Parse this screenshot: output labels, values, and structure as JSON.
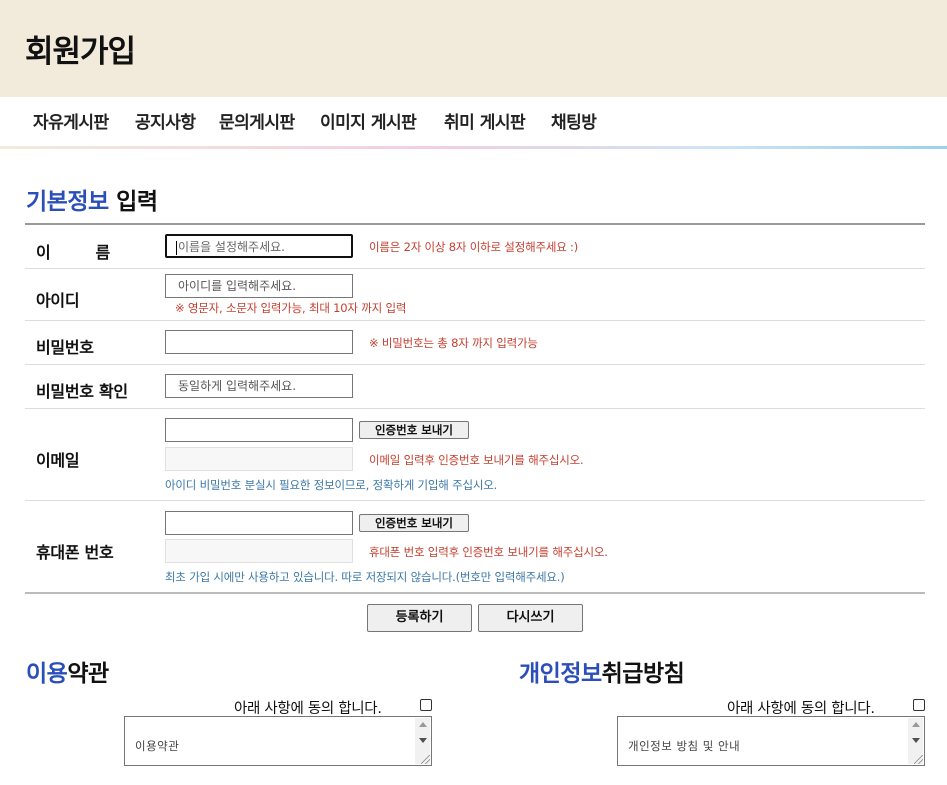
{
  "header": {
    "title": "회원가입"
  },
  "nav": {
    "items": [
      "자유게시판",
      "공지사항",
      "문의게시판",
      "이미지 게시판",
      "취미 게시판",
      "채팅방"
    ]
  },
  "section": {
    "title_accent": "기본정보",
    "title_rest": "입력"
  },
  "form": {
    "name": {
      "label": "이    름",
      "placeholder": "이름을 설정해주세요.",
      "hint": "이름은 2자 이상 8자 이하로 설정해주세요 :)"
    },
    "id": {
      "label": "아이디",
      "placeholder": "아이디를 입력해주세요.",
      "hint": "※ 영문자, 소문자 입력가능, 최대 10자 까지 입력"
    },
    "password": {
      "label": "비밀번호",
      "placeholder": "",
      "hint": "※ 비밀번호는 총 8자 까지 입력가능"
    },
    "password_confirm": {
      "label": "비밀번호 확인",
      "placeholder": "동일하게 입력해주세요."
    },
    "email": {
      "label": "이메일",
      "send_button": "인증번호 보내기",
      "hint": "이메일 입력후 인증번호 보내기를 해주십시오.",
      "note": "아이디 비밀번호 분실시 필요한 정보이므로, 정확하게 기입해 주십시오."
    },
    "phone": {
      "label": "휴대폰 번호",
      "send_button": "인증번호 보내기",
      "hint": "휴대폰 번호 입력후 인증번호 보내기를 해주십시오.",
      "note": "최초 가입 시에만 사용하고 있습니다. 따로 저장되지 않습니다.(번호만 입력해주세요.)"
    }
  },
  "actions": {
    "submit": "등록하기",
    "reset": "다시쓰기"
  },
  "terms": {
    "title_accent": "이용",
    "title_rest": "약관",
    "agree_label": "아래 사항에 동의 합니다.",
    "content": "이용약관"
  },
  "privacy": {
    "title_accent": "개인정보",
    "title_rest": "취급방침",
    "agree_label": "아래 사항에 동의 합니다.",
    "content": "개인정보 방침 및 안내"
  }
}
